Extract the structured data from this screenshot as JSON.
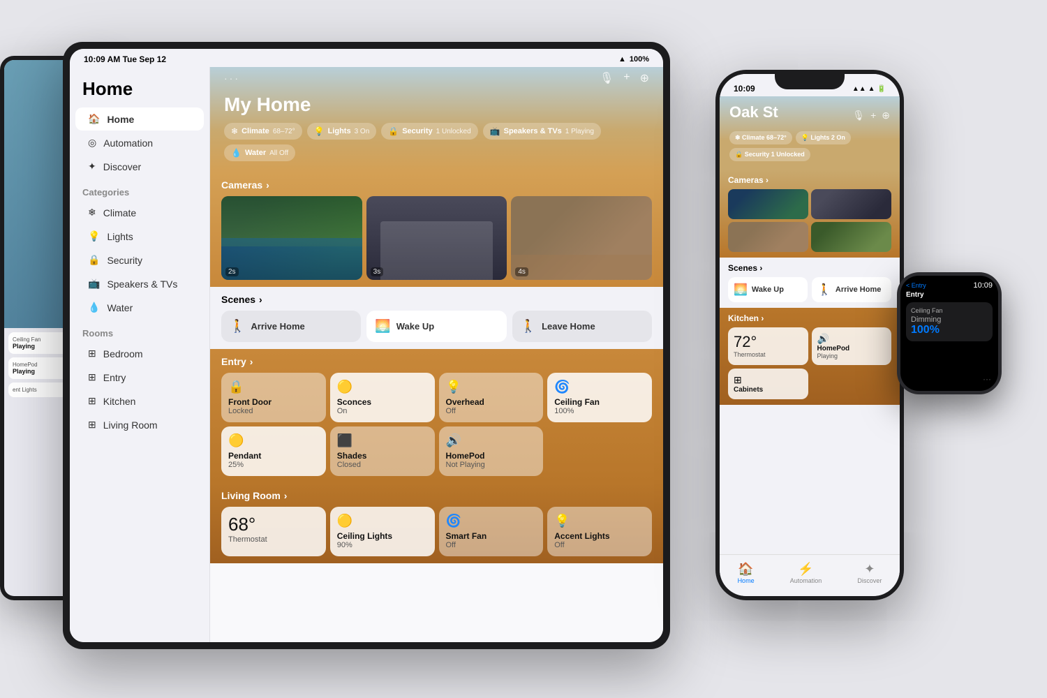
{
  "scene": {
    "background_color": "#e5e5ea"
  },
  "ipad_small": {
    "visible": true
  },
  "ipad": {
    "status_bar": {
      "time": "10:09 AM  Tue Sep 12",
      "wifi": "WiFi",
      "battery": "100%"
    },
    "sidebar": {
      "title": "Home",
      "nav_items": [
        {
          "label": "Home",
          "icon": "🏠",
          "active": true
        },
        {
          "label": "Automation",
          "icon": "◎"
        },
        {
          "label": "Discover",
          "icon": "✦"
        }
      ],
      "categories_title": "Categories",
      "categories": [
        {
          "label": "Climate",
          "icon": "❄"
        },
        {
          "label": "Lights",
          "icon": "💡"
        },
        {
          "label": "Security",
          "icon": "🔒"
        },
        {
          "label": "Speakers & TVs",
          "icon": "📺"
        },
        {
          "label": "Water",
          "icon": "💧"
        }
      ],
      "rooms_title": "Rooms",
      "rooms": [
        {
          "label": "Bedroom",
          "icon": "⊞"
        },
        {
          "label": "Entry",
          "icon": "⊞"
        },
        {
          "label": "Kitchen",
          "icon": "⊞"
        },
        {
          "label": "Living Room",
          "icon": "⊞"
        }
      ]
    },
    "main": {
      "title": "My Home",
      "topbar_dots": "···",
      "add_icon": "+",
      "more_icon": "⊕",
      "pills": [
        {
          "icon": "❄",
          "label": "Climate",
          "sub": "68–72°"
        },
        {
          "icon": "💡",
          "label": "Lights",
          "sub": "3 On"
        },
        {
          "icon": "🔒",
          "label": "Security",
          "sub": "1 Unlocked"
        },
        {
          "icon": "📺",
          "label": "Speakers & TVs",
          "sub": "1 Playing"
        },
        {
          "icon": "💧",
          "label": "Water",
          "sub": "All Off"
        }
      ],
      "cameras_header": "Cameras",
      "cameras": [
        {
          "label": "2s"
        },
        {
          "label": "3s"
        },
        {
          "label": "4s"
        }
      ],
      "scenes_header": "Scenes",
      "scenes": [
        {
          "icon": "🚶",
          "label": "Arrive Home"
        },
        {
          "icon": "🌅",
          "label": "Wake Up"
        },
        {
          "icon": "🚶",
          "label": "Leave Home"
        }
      ],
      "entry_header": "Entry",
      "entry_devices": [
        {
          "icon": "🔒",
          "name": "",
          "status": "Front Door\nLocked",
          "on": false
        },
        {
          "icon": "🟡",
          "name": "Sconces",
          "status": "On",
          "on": true
        },
        {
          "icon": "💡",
          "name": "Overhead",
          "status": "Off",
          "on": false
        },
        {
          "icon": "🌀",
          "name": "Ceiling Fan",
          "status": "100%",
          "on": true
        },
        {
          "icon": "🟡",
          "name": "Pendant",
          "status": "25%",
          "on": true
        },
        {
          "icon": "📱",
          "name": "Shades",
          "status": "Closed",
          "on": false
        },
        {
          "icon": "🔊",
          "name": "HomePod",
          "status": "Not Playing",
          "on": false
        }
      ],
      "living_room_header": "Living Room",
      "living_devices": [
        {
          "temp": "68°",
          "label": "Thermostat"
        },
        {
          "icon": "🟡",
          "name": "Ceiling Lights",
          "status": "90%"
        },
        {
          "icon": "🌀",
          "name": "Smart Fan",
          "status": "Off"
        },
        {
          "icon": "💡",
          "name": "Accent Lights",
          "status": "Off"
        }
      ]
    }
  },
  "iphone": {
    "time": "10:09",
    "status_icons": "▲▲▲ 🔋",
    "title": "Oak St",
    "pills": [
      {
        "label": "Climate 68–72°"
      },
      {
        "label": "Lights 2 On"
      },
      {
        "label": "Security 1 Unlocked"
      }
    ],
    "cameras_header": "Cameras",
    "scenes_header": "Scenes",
    "scenes": [
      {
        "icon": "🌅",
        "label": "Wake Up"
      },
      {
        "icon": "🚶",
        "label": "Arrive Home"
      }
    ],
    "kitchen_header": "Kitchen",
    "kitchen_items": [
      {
        "icon": "🌡",
        "temp": "72°",
        "label": "Thermostat"
      },
      {
        "icon": "🔊",
        "name": "HomePod",
        "status": "Playing"
      },
      {
        "icon": "⊞",
        "name": "Cabinets",
        "status": ""
      }
    ],
    "tabs": [
      {
        "icon": "🏠",
        "label": "Home",
        "active": true
      },
      {
        "icon": "⚡",
        "label": "Automation",
        "active": false
      },
      {
        "icon": "✦",
        "label": "Discover",
        "active": false
      }
    ]
  },
  "watch": {
    "time": "10:09",
    "back_label": "< Entry",
    "room": "Entry",
    "card1": {
      "title": "Dimming",
      "value": "100%"
    },
    "device_label": "Ceiling Fan"
  }
}
